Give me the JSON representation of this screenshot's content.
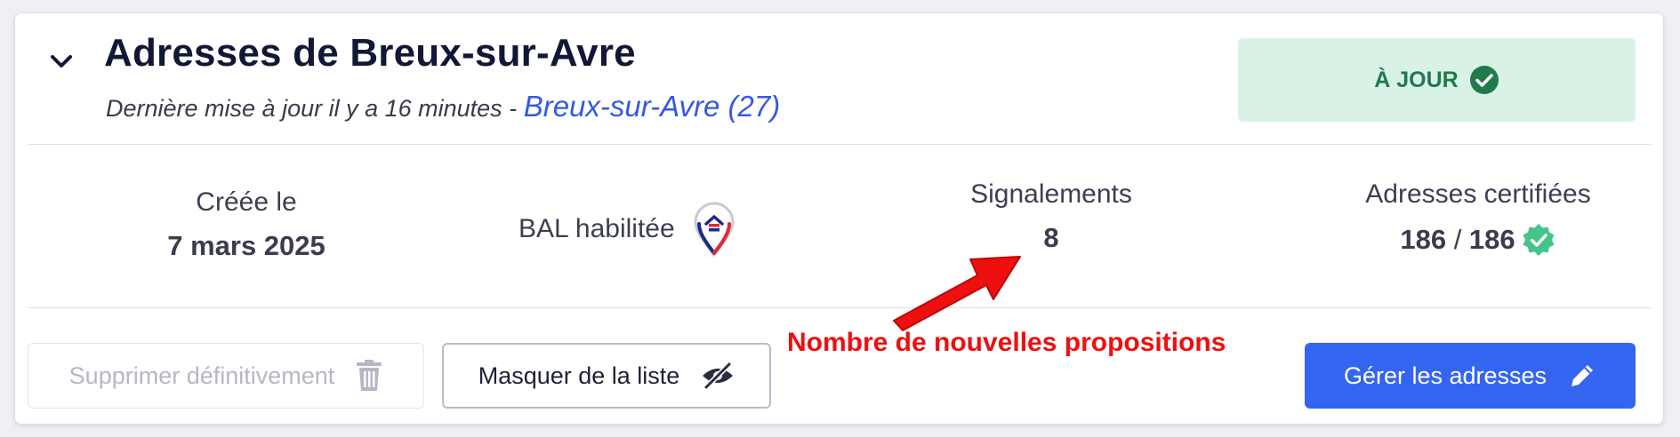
{
  "header": {
    "title": "Adresses de Breux-sur-Avre",
    "subtitle_prefix": "Dernière mise à jour il y a 16 minutes - ",
    "commune_link": "Breux-sur-Avre (27)",
    "status_badge": "À JOUR"
  },
  "stats": {
    "created_label": "Créée le",
    "created_value": "7 mars 2025",
    "bal_label": "BAL habilitée",
    "signalements_label": "Signalements",
    "signalements_value": "8",
    "certified_label": "Adresses certifiées",
    "certified_count": "186",
    "certified_separator": " / ",
    "certified_total": "186"
  },
  "actions": {
    "delete_label": "Supprimer définitivement",
    "hide_label": "Masquer de la liste",
    "manage_label": "Gérer les adresses"
  },
  "annotation": {
    "text": "Nombre de nouvelles propositions"
  },
  "colors": {
    "accent": "#3465f0",
    "badge_bg": "#d9f2e6",
    "badge_text": "#207a4c",
    "annotation": "#ee0f0f"
  },
  "icons": {
    "collapse": "chevron-down-icon",
    "badge": "check-circle-icon",
    "bal": "map-pin-icon",
    "certified": "verified-badge-icon",
    "delete": "trash-icon",
    "hide": "eye-slash-icon",
    "manage": "pencil-icon"
  }
}
